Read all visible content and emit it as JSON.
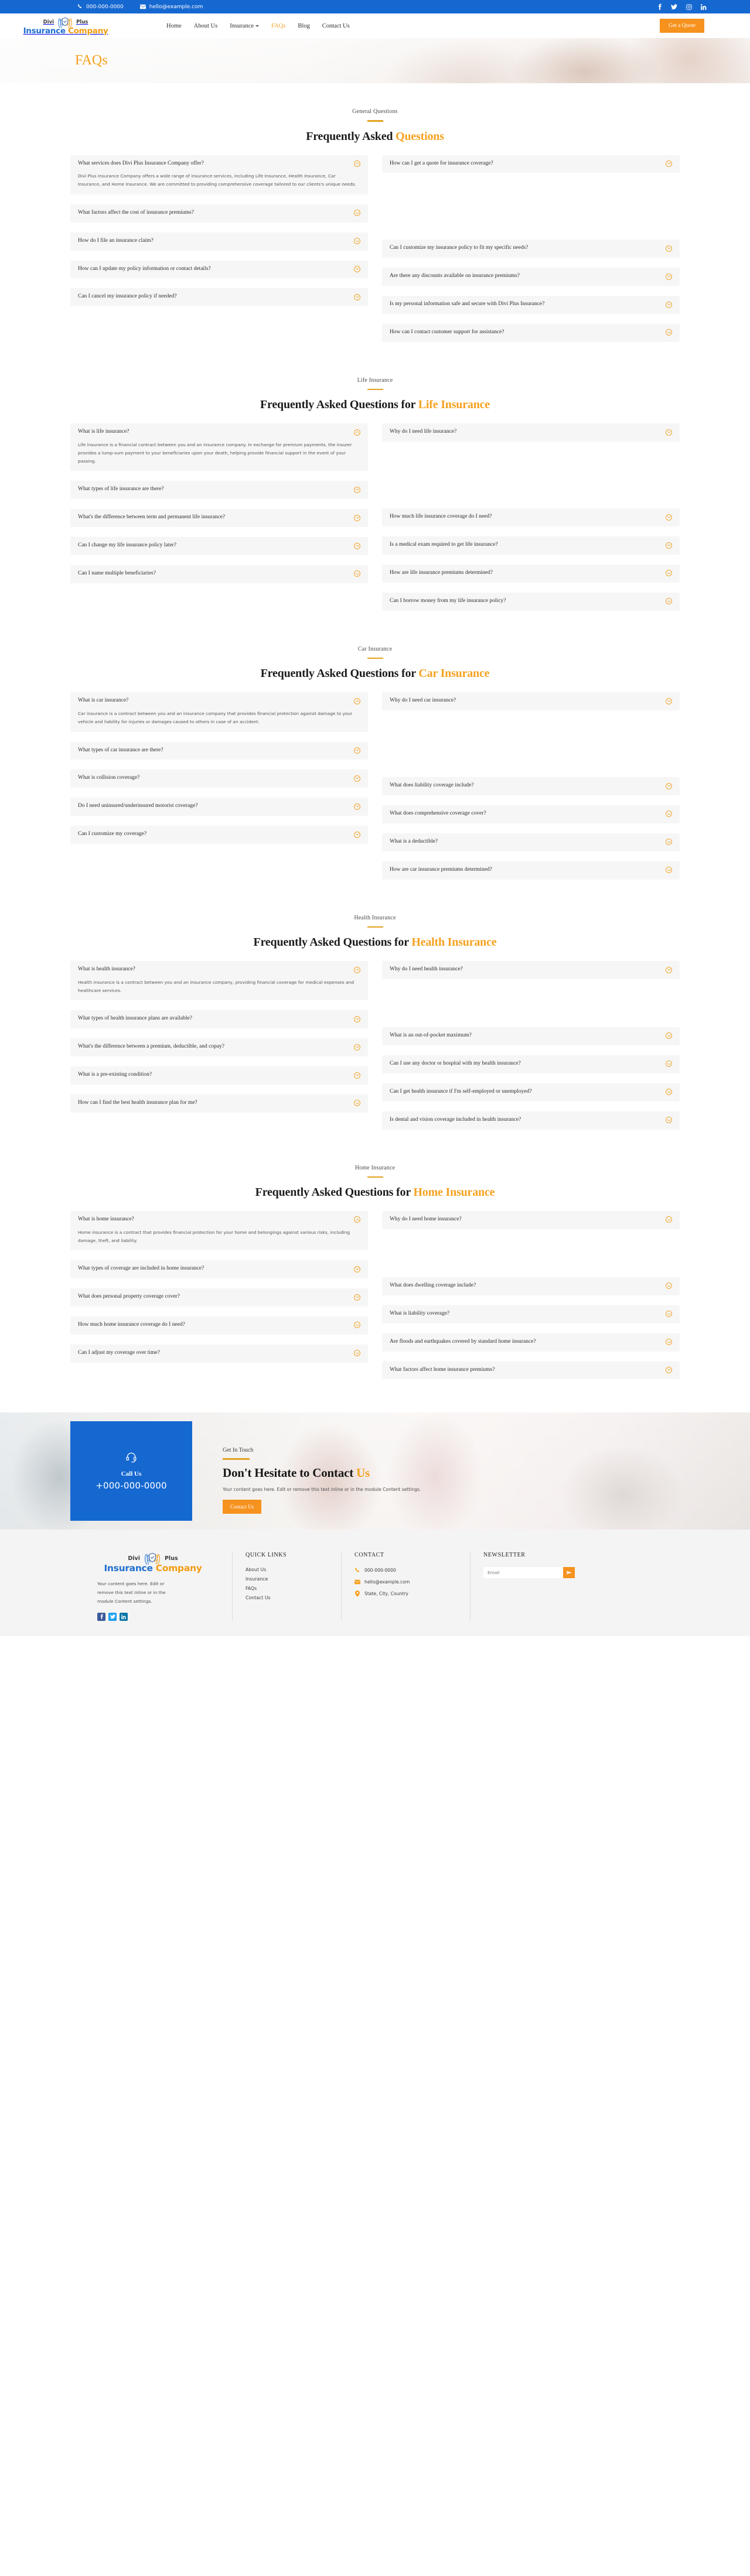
{
  "topbar": {
    "phone": "000-000-0000",
    "email": "hello@example.com",
    "socials": [
      "facebook-icon",
      "twitter-icon",
      "instagram-icon",
      "linkedin-icon"
    ]
  },
  "brand": {
    "word_divi": "Divi",
    "word_plus": "Plus",
    "word_insurance": "Insurance",
    "word_company": "Company"
  },
  "nav": {
    "items": [
      {
        "label": "Home",
        "active": false,
        "caret": false
      },
      {
        "label": "About Us",
        "active": false,
        "caret": false
      },
      {
        "label": "Insurance",
        "active": false,
        "caret": true
      },
      {
        "label": "FAQs",
        "active": true,
        "caret": false
      },
      {
        "label": "Blog",
        "active": false,
        "caret": false
      },
      {
        "label": "Contact Us",
        "active": false,
        "caret": false
      }
    ],
    "cta_label": "Get a Quote"
  },
  "hero": {
    "title": "FAQs"
  },
  "sections": [
    {
      "eyebrow": "General Questions",
      "title_plain": "Frequently Asked ",
      "title_accent": "Questions",
      "left": [
        {
          "q": "What services does Divi Plus Insurance Company offer?",
          "open": true,
          "a": "Divi Plus Insurance Company offers a wide range of insurance services, including Life Insurance, Health Insurance, Car Insurance, and Home Insurance. We are committed to providing comprehensive coverage tailored to our clients's unique needs."
        },
        {
          "q": "What factors affect the cost of insurance premiums?",
          "open": false,
          "a": ""
        },
        {
          "q": "How do I file an insurance claim?",
          "open": false,
          "a": ""
        },
        {
          "q": "How can I update my policy information or contact details?",
          "open": false,
          "a": ""
        },
        {
          "q": "Can I cancel my insurance policy if needed?",
          "open": false,
          "a": ""
        }
      ],
      "right": [
        {
          "q": "How can I get a quote for insurance coverage?",
          "open": false,
          "a": ""
        },
        {
          "q": "Can I customize my insurance policy to fit my specific needs?",
          "open": false,
          "a": ""
        },
        {
          "q": "Are there any discounts available on insurance premiums?",
          "open": false,
          "a": ""
        },
        {
          "q": "Is my personal information safe and secure with Divi Plus Insurance?",
          "open": false,
          "a": ""
        },
        {
          "q": "How can I contact customer support for assistance?",
          "open": false,
          "a": ""
        }
      ]
    },
    {
      "eyebrow": "Life Insurance",
      "title_plain": "Frequently Asked Questions for ",
      "title_accent": "Life Insurance",
      "left": [
        {
          "q": "What is life insurance?",
          "open": true,
          "a": "Life insurance is a financial contract between you and an insurance company. In exchange for premium payments, the insurer provides a lump-sum payment to your beneficiaries upon your death, helping provide financial support in the event of your passing."
        },
        {
          "q": "What types of life insurance are there?",
          "open": false,
          "a": ""
        },
        {
          "q": "What's the difference between term and permanent life insurance?",
          "open": false,
          "a": ""
        },
        {
          "q": "Can I change my life insurance policy later?",
          "open": false,
          "a": ""
        },
        {
          "q": "Can I name multiple beneficiaries?",
          "open": false,
          "a": ""
        }
      ],
      "right": [
        {
          "q": "Why do I need life insurance?",
          "open": false,
          "a": ""
        },
        {
          "q": "How much life insurance coverage do I need?",
          "open": false,
          "a": ""
        },
        {
          "q": "Is a medical exam required to get life insurance?",
          "open": false,
          "a": ""
        },
        {
          "q": "How are life insurance premiums determined?",
          "open": false,
          "a": ""
        },
        {
          "q": "Can I borrow money from my life insurance policy?",
          "open": false,
          "a": ""
        }
      ]
    },
    {
      "eyebrow": "Car Insurance",
      "title_plain": "Frequently Asked Questions for ",
      "title_accent": "Car Insurance",
      "left": [
        {
          "q": "What is car insurance?",
          "open": true,
          "a": "Car insurance is a contract between you and an insurance company that provides financial protection against damage to your vehicle and liability for injuries or damages caused to others in case of an accident."
        },
        {
          "q": "What types of car insurance are there?",
          "open": false,
          "a": ""
        },
        {
          "q": "What is collision coverage?",
          "open": false,
          "a": ""
        },
        {
          "q": "Do I need uninsured/underinsured motorist coverage?",
          "open": false,
          "a": ""
        },
        {
          "q": "Can I customize my coverage?",
          "open": false,
          "a": ""
        }
      ],
      "right": [
        {
          "q": "Why do I need car insurance?",
          "open": false,
          "a": ""
        },
        {
          "q": "What does liability coverage include?",
          "open": false,
          "a": ""
        },
        {
          "q": "What does comprehensive coverage cover?",
          "open": false,
          "a": ""
        },
        {
          "q": "What is a deductible?",
          "open": false,
          "a": ""
        },
        {
          "q": "How are car insurance premiums determined?",
          "open": false,
          "a": ""
        }
      ]
    },
    {
      "eyebrow": "Health Insurance",
      "title_plain": "Frequently Asked Questions for ",
      "title_accent": "Health Insurance",
      "left": [
        {
          "q": "What is health insurance?",
          "open": true,
          "a": "Health insurance is a contract between you and an insurance company, providing financial coverage for medical expenses and healthcare services."
        },
        {
          "q": "What types of health insurance plans are available?",
          "open": false,
          "a": ""
        },
        {
          "q": "What's the difference between a premium, deductible, and copay?",
          "open": false,
          "a": ""
        },
        {
          "q": "What is a pre-existing condition?",
          "open": false,
          "a": ""
        },
        {
          "q": "How can I find the best health insurance plan for me?",
          "open": false,
          "a": ""
        }
      ],
      "right": [
        {
          "q": "Why do I need health insurance?",
          "open": false,
          "a": ""
        },
        {
          "q": "What is an out-of-pocket maximum?",
          "open": false,
          "a": ""
        },
        {
          "q": "Can I use any doctor or hospital with my health insurance?",
          "open": false,
          "a": ""
        },
        {
          "q": "Can I get health insurance if I'm self-employed or unemployed?",
          "open": false,
          "a": ""
        },
        {
          "q": "Is dental and vision coverage included in health insurance?",
          "open": false,
          "a": ""
        }
      ]
    },
    {
      "eyebrow": "Home Insurance",
      "title_plain": "Frequently Asked Questions for ",
      "title_accent": "Home Insurance",
      "left": [
        {
          "q": "What is home insurance?",
          "open": true,
          "a": "Home insurance is a contract that provides financial protection for your home and belongings against various risks, including damage, theft, and liability."
        },
        {
          "q": "What types of coverage are included in home insurance?",
          "open": false,
          "a": ""
        },
        {
          "q": "What does personal property coverage cover?",
          "open": false,
          "a": ""
        },
        {
          "q": "How much home insurance coverage do I need?",
          "open": false,
          "a": ""
        },
        {
          "q": "Can I adjust my coverage over time?",
          "open": false,
          "a": ""
        }
      ],
      "right": [
        {
          "q": "Why do I need home insurance?",
          "open": false,
          "a": ""
        },
        {
          "q": "What does dwelling coverage include?",
          "open": false,
          "a": ""
        },
        {
          "q": "What is liability coverage?",
          "open": false,
          "a": ""
        },
        {
          "q": "Are floods and earthquakes covered by standard home insurance?",
          "open": false,
          "a": ""
        },
        {
          "q": "What factors affect home insurance premiums?",
          "open": false,
          "a": ""
        }
      ]
    }
  ],
  "cta": {
    "call_label": "Call Us",
    "call_number": "+000-000-0000",
    "eyebrow": "Get In Touch",
    "title_plain": "Don't Hesitate to Contact ",
    "title_accent": "Us",
    "paragraph": "Your content goes here. Edit or remove this text inline or in the module Content settings.",
    "button_label": "Contact Us"
  },
  "footer": {
    "about_text": "Your content goes here. Edit or remove this text inline or in the module Content settings.",
    "socials": [
      "facebook-icon",
      "twitter-icon",
      "linkedin-icon"
    ],
    "quick_links_title": "QUICK LINKS",
    "quick_links": [
      "About Us",
      "Insurance",
      "FAQs",
      "Contact Us"
    ],
    "contact_title": "CONTACT",
    "contact": [
      {
        "icon": "phone-icon",
        "text": "000-000-0000"
      },
      {
        "icon": "envelope-icon",
        "text": "hello@example.com"
      },
      {
        "icon": "map-pin-icon",
        "text": "State, City, Country"
      }
    ],
    "newsletter_title": "NEWSLETTER",
    "newsletter_placeholder": "Email",
    "newsletter_value": ""
  },
  "colors": {
    "brand_blue": "#1668d1",
    "accent_orange": "#f5a11f",
    "button_orange": "#f6921e",
    "card_gray": "#f6f6f6"
  }
}
